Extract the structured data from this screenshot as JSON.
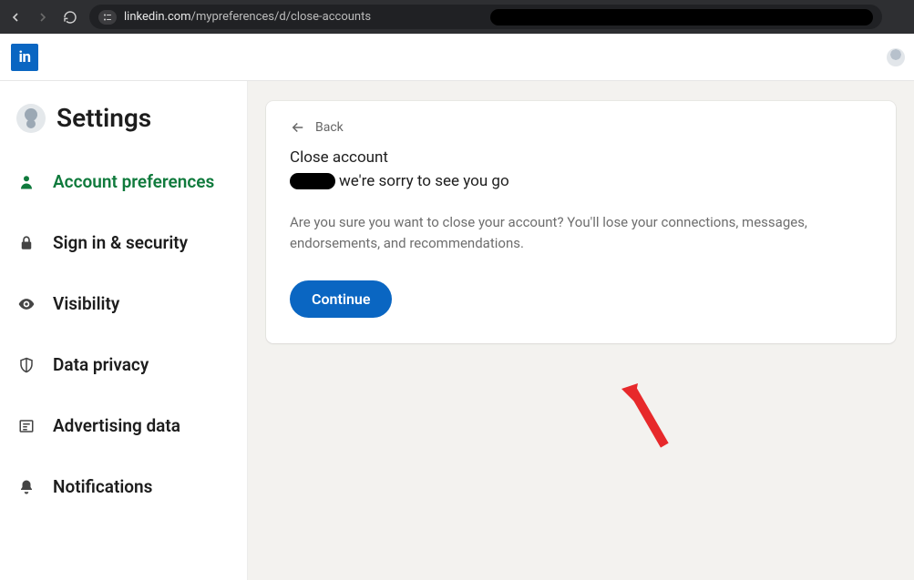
{
  "browser": {
    "url_domain": "linkedin.com",
    "url_path": "/mypreferences/d/close-accounts"
  },
  "header": {
    "logo_text": "in"
  },
  "sidebar": {
    "title": "Settings",
    "items": [
      {
        "label": "Account preferences",
        "icon": "person-icon",
        "active": true
      },
      {
        "label": "Sign in & security",
        "icon": "lock-icon",
        "active": false
      },
      {
        "label": "Visibility",
        "icon": "eye-icon",
        "active": false
      },
      {
        "label": "Data privacy",
        "icon": "shield-icon",
        "active": false
      },
      {
        "label": "Advertising data",
        "icon": "newspaper-icon",
        "active": false
      },
      {
        "label": "Notifications",
        "icon": "bell-icon",
        "active": false
      }
    ]
  },
  "card": {
    "back_label": "Back",
    "title": "Close account",
    "subtitle_suffix": "we're sorry to see you go",
    "body": "Are you sure you want to close your account? You'll lose your connections, messages, endorsements, and recommendations.",
    "continue_label": "Continue"
  }
}
